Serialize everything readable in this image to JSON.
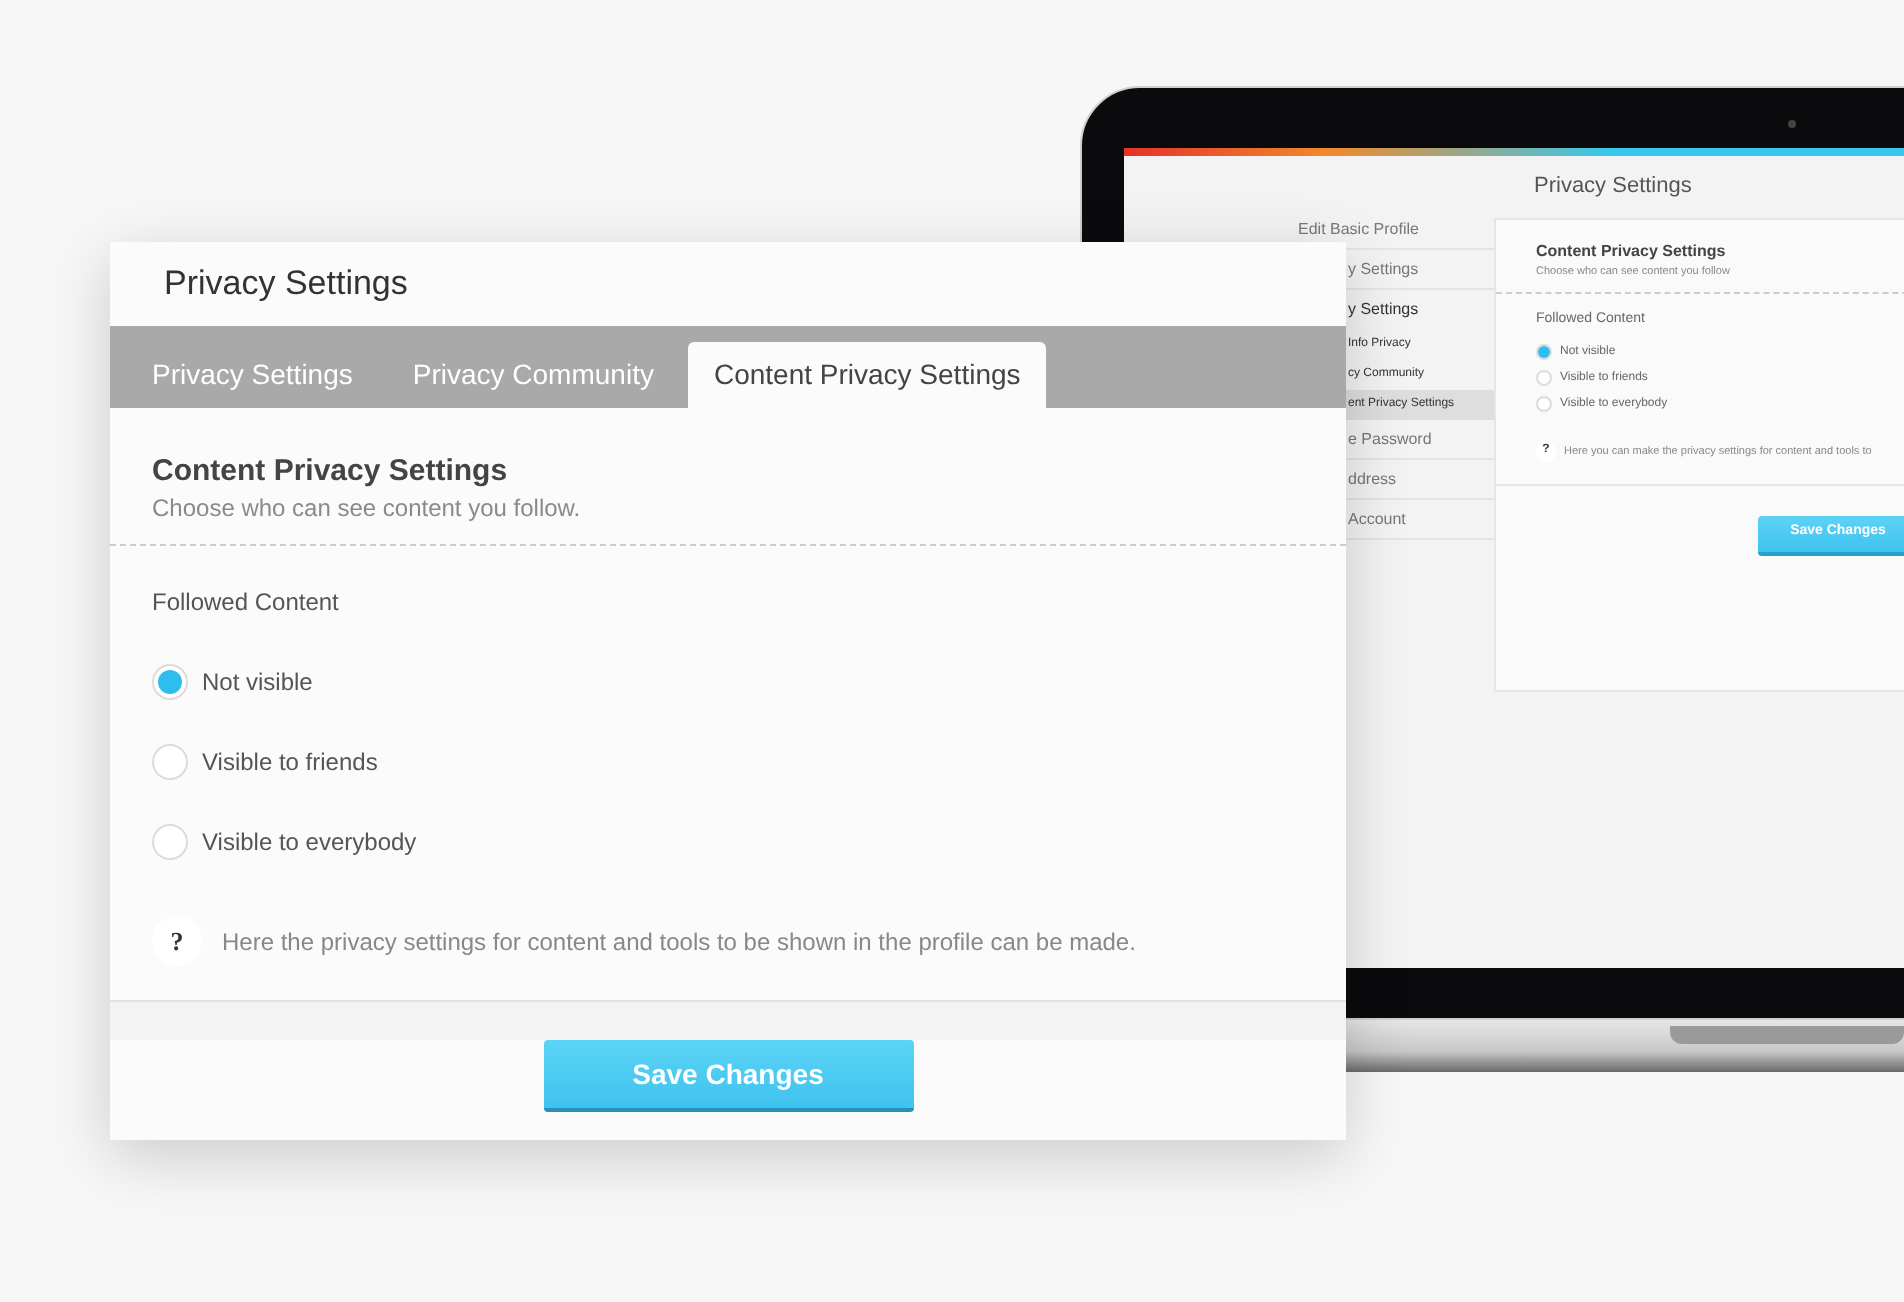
{
  "laptop_screen": {
    "sidebar": {
      "items": [
        {
          "label": "Edit Basic Profile",
          "kind": "link",
          "selected": false
        },
        {
          "label": "y Settings",
          "kind": "link",
          "selected": false
        },
        {
          "label": "y Settings",
          "kind": "heading",
          "selected": false
        },
        {
          "label": "Info Privacy",
          "kind": "sub",
          "selected": false
        },
        {
          "label": "cy Community",
          "kind": "sub",
          "selected": false
        },
        {
          "label": "ent Privacy Settings",
          "kind": "sub",
          "selected": true
        },
        {
          "label": "e Password",
          "kind": "link",
          "selected": false
        },
        {
          "label": "ddress",
          "kind": "link",
          "selected": false
        },
        {
          "label": "Account",
          "kind": "link",
          "selected": false
        }
      ]
    },
    "page_title": "Privacy Settings",
    "heading": "Content Privacy Settings",
    "subtitle": "Choose who can see content you follow",
    "group_label": "Followed Content",
    "options": [
      {
        "label": "Not visible",
        "selected": true
      },
      {
        "label": "Visible to friends",
        "selected": false
      },
      {
        "label": "Visible to everybody",
        "selected": false
      }
    ],
    "help_mark": "?",
    "help_text": "Here you can make the privacy settings for content and tools to",
    "save_button": "Save Changes"
  },
  "dialog": {
    "title": "Privacy Settings",
    "tabs": [
      {
        "label": "Privacy Settings",
        "selected": false
      },
      {
        "label": "Privacy Community",
        "selected": false
      },
      {
        "label": "Content Privacy Settings",
        "selected": true
      }
    ],
    "heading": "Content Privacy Settings",
    "subtitle": "Choose who can see content you follow.",
    "group_label": "Followed Content",
    "options": [
      {
        "label": "Not visible",
        "selected": true
      },
      {
        "label": "Visible to friends",
        "selected": false
      },
      {
        "label": "Visible to everybody",
        "selected": false
      }
    ],
    "help_mark": "?",
    "help_text": "Here the privacy settings for content and tools to be shown in the profile can be made.",
    "save_button": "Save Changes"
  }
}
